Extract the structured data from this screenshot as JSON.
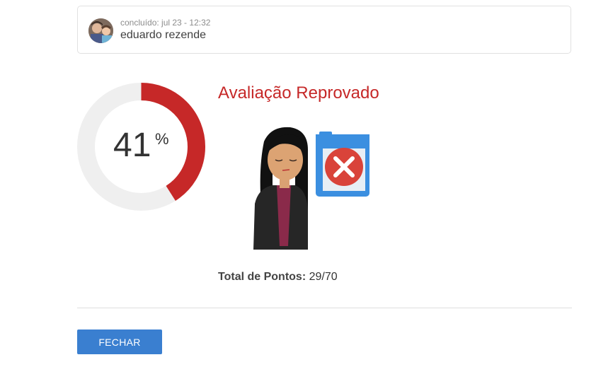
{
  "header": {
    "completed": "concluído: jul 23 - 12:32",
    "user_name": "eduardo rezende"
  },
  "score": {
    "percent": 41,
    "percent_text": "41",
    "percent_sign": "%",
    "ring_color": "#c62828",
    "track_color": "#efefef"
  },
  "result": {
    "title": "Avaliação Reprovado",
    "title_color": "#c62828",
    "illustration": "woman-with-failed-document-icon"
  },
  "points": {
    "label": "Total de Pontos:",
    "value": "29/70"
  },
  "actions": {
    "close_label": "FECHAR",
    "button_color": "#3a7fd0"
  }
}
